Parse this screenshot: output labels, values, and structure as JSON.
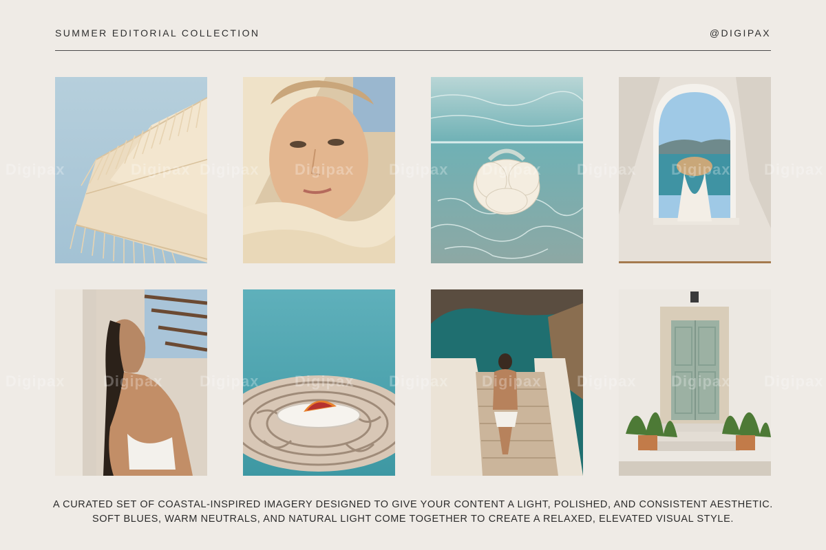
{
  "header": {
    "title": "SUMMER EDITORIAL COLLECTION",
    "handle": "@DIGIPAX"
  },
  "watermark": {
    "text": "Digipax"
  },
  "tiles": [
    {
      "subject": "fringed-parasol"
    },
    {
      "subject": "woman-in-scarf"
    },
    {
      "subject": "underwater-fabric"
    },
    {
      "subject": "arched-window-sea-view"
    },
    {
      "subject": "woman-against-wall"
    },
    {
      "subject": "orange-plate-mosaic-table"
    },
    {
      "subject": "steps-to-sea-cove"
    },
    {
      "subject": "green-door-with-plants"
    }
  ],
  "caption": {
    "line1": "A CURATED SET OF COASTAL-INSPIRED IMAGERY DESIGNED TO GIVE YOUR CONTENT A LIGHT, POLISHED, AND CONSISTENT AESTHETIC.",
    "line2": "SOFT BLUES, WARM NEUTRALS, AND NATURAL LIGHT COME TOGETHER TO CREATE A RELAXED, ELEVATED VISUAL STYLE."
  },
  "colors": {
    "background": "#efebe6",
    "text": "#2b2b2b",
    "sky_blue": "#a9c6d6",
    "sea_teal": "#3f9aa3",
    "sand": "#e8d9c2"
  }
}
